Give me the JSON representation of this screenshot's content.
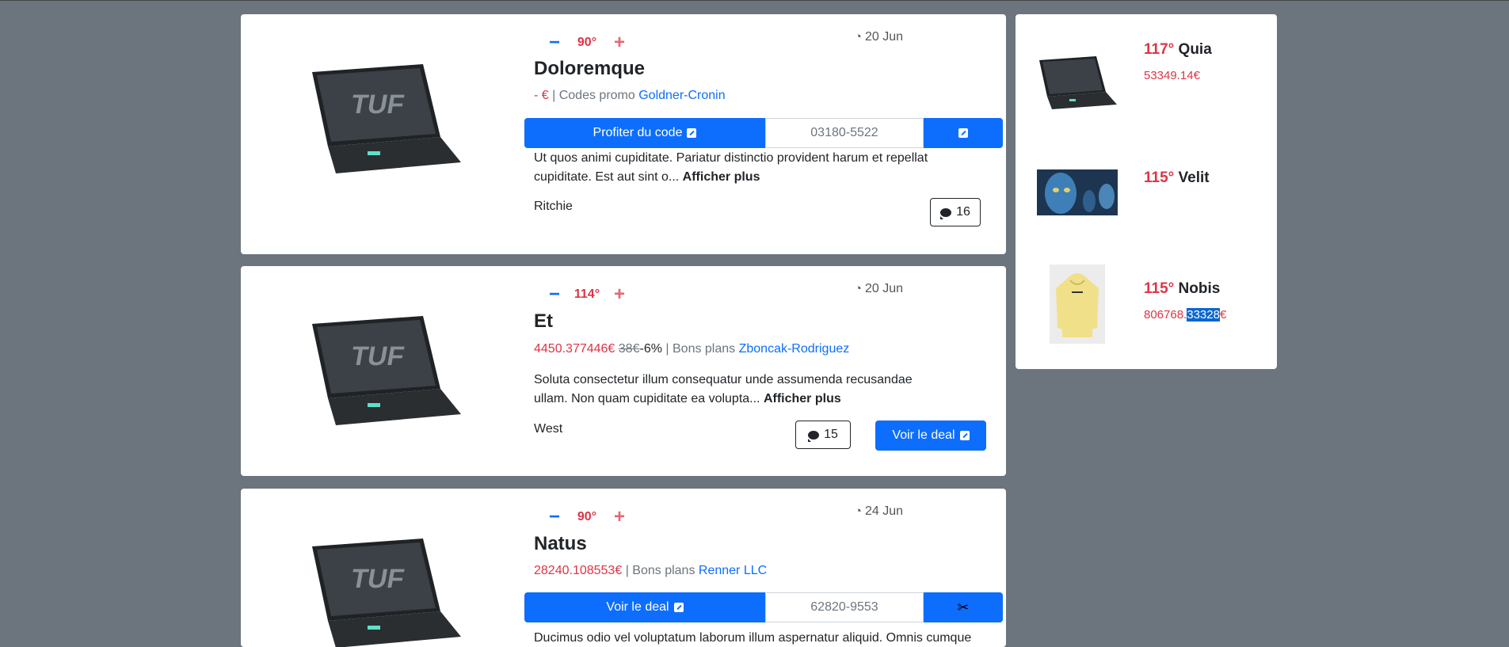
{
  "deals": [
    {
      "temperature": "90°",
      "date": "20 Jun",
      "title": "Doloremque",
      "price": "- €",
      "category": "| Codes promo",
      "shop": "Goldner-Cronin",
      "cta_label": "Profiter du code",
      "code": "03180-5522",
      "description": "Ut quos animi cupiditate. Pariatur distinctio provident harum et repellat cupiditate. Est aut sint o...",
      "more_label": "Afficher plus",
      "author": "Ritchie",
      "comments": "16"
    },
    {
      "temperature": "114°",
      "date": "20 Jun",
      "title": "Et",
      "price": "4450.377446€",
      "old_price": "38€",
      "discount": "-6%",
      "category": "| Bons plans",
      "shop": "Zboncak-Rodriguez",
      "description": "Soluta consectetur illum consequatur unde assumenda recusandae ullam. Non quam cupiditate ea volupta...",
      "more_label": "Afficher plus",
      "author": "West",
      "comments": "15",
      "cta_label": "Voir le deal"
    },
    {
      "temperature": "90°",
      "date": "24 Jun",
      "title": "Natus",
      "price": "28240.108553€",
      "category": "| Bons plans",
      "shop": "Renner LLC",
      "cta_label": "Voir le deal",
      "code": "62820-9553",
      "description": "Ducimus odio vel voluptatum laborum illum aspernatur aliquid. Omnis cumque"
    }
  ],
  "sidebar": [
    {
      "temperature": "117°",
      "title": "Quia",
      "price": "53349.14€"
    },
    {
      "temperature": "115°",
      "title": "Velit",
      "price": ""
    },
    {
      "temperature": "115°",
      "title": "Nobis",
      "price_a": "806768.",
      "price_sel": "33328",
      "price_b": "€"
    }
  ],
  "icons": {
    "minus": "−",
    "plus": "+",
    "scissors": "✂",
    "flame": "🔥"
  },
  "colors": {
    "primary": "#0d6efd",
    "hot": "#dc3545",
    "background": "#6c757d"
  }
}
